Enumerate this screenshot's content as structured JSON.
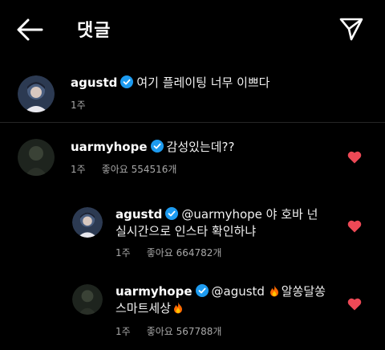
{
  "header": {
    "title": "댓글"
  },
  "caption": {
    "username": "agustd",
    "text": "여기 플레이팅 너무 이쁘다",
    "time": "1주"
  },
  "comments": [
    {
      "username": "uarmyhope",
      "text": "감성있는데??",
      "time": "1주",
      "likes": "좋아요 554516개"
    }
  ],
  "replies": [
    {
      "username": "agustd",
      "text_line1": "@uarmyhope 야 호바 넌",
      "text_line2": "실시간으로 인스타 확인하냐",
      "time": "1주",
      "likes": "좋아요 664782개"
    },
    {
      "username": "uarmyhope",
      "text_line1_a": "@agustd ",
      "text_line1_b": "알쏭달쏭",
      "text_line2": "스마트세상",
      "time": "1주",
      "likes": "좋아요 567788개"
    }
  ],
  "colors": {
    "background": "#000000",
    "verified": "#1d9bf0",
    "heart": "#ed4956",
    "muted": "#a8a8a8"
  }
}
